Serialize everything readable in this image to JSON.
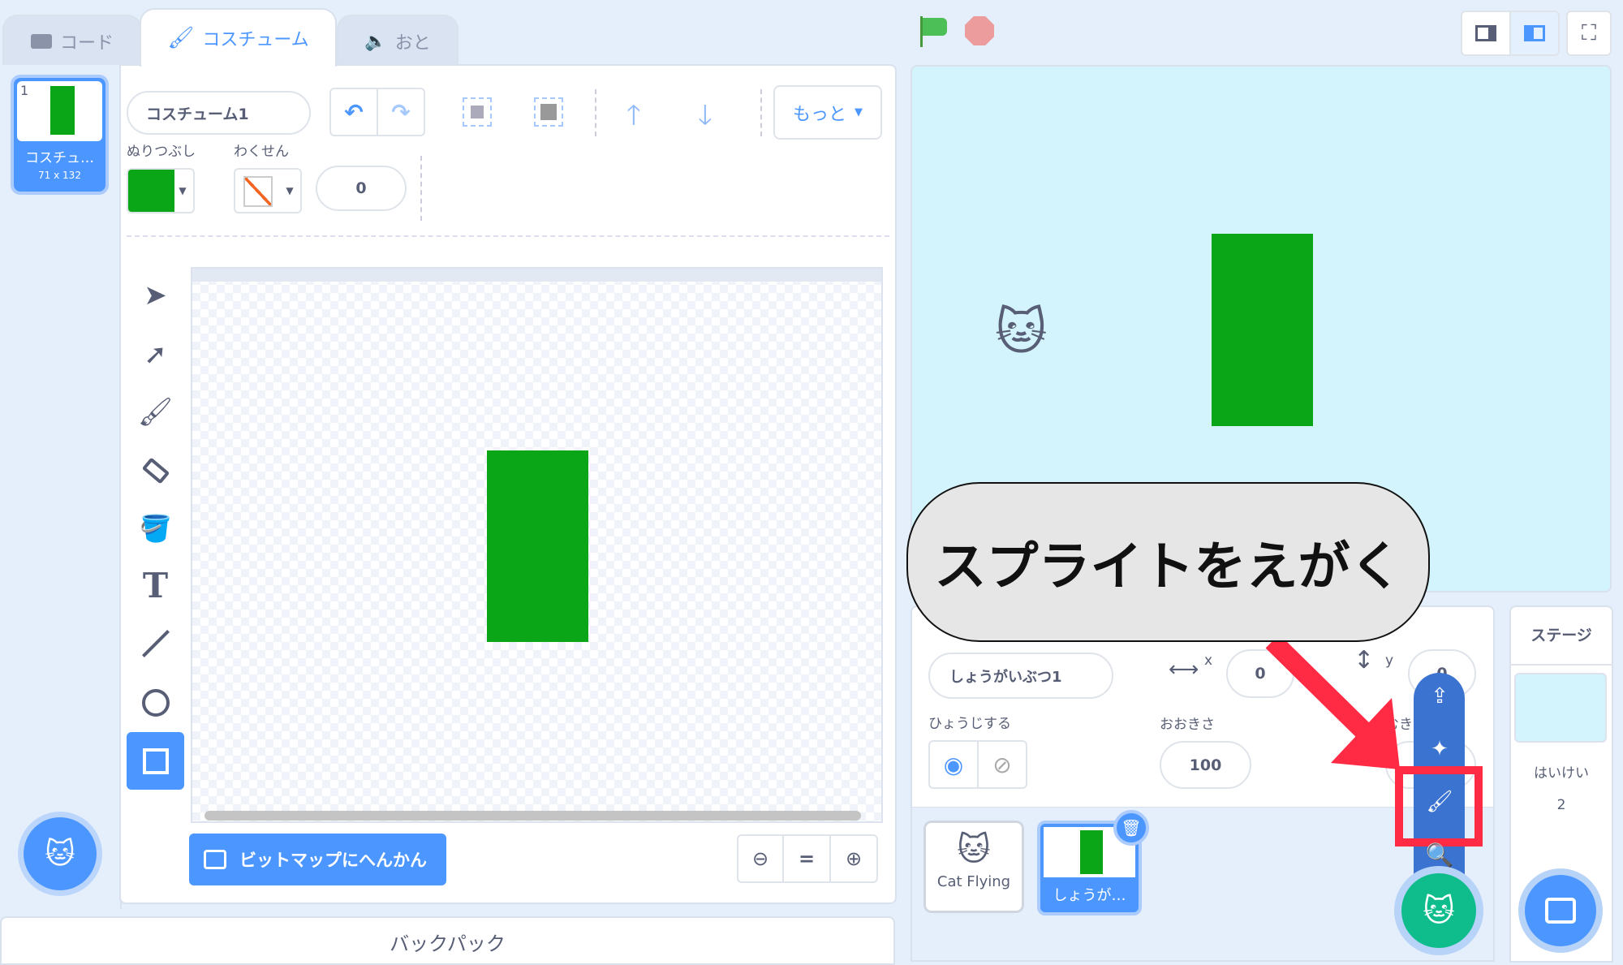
{
  "tabs": [
    {
      "label": "コード",
      "icon": "code-icon"
    },
    {
      "label": "コスチューム",
      "icon": "brush-icon"
    },
    {
      "label": "おと",
      "icon": "speaker-icon"
    }
  ],
  "costume_list": [
    {
      "number": "1",
      "name": "コスチュ…",
      "size": "71 x 132"
    }
  ],
  "editor": {
    "costume_name": "コスチューム1",
    "more_label": "もっと",
    "fill_label": "ぬりつぶし",
    "outline_label": "わくせん",
    "fill_color": "#0aa617",
    "outline_width": "0",
    "convert_label": "ビットマップにへんかん",
    "zoom_reset": "="
  },
  "backpack_label": "バックパック",
  "stage": {
    "background": "#d3f4fc",
    "shape_color": "#0aa617"
  },
  "callout": "スプライトをえがく",
  "sprite_info": {
    "name": "しょうがいぶつ1",
    "x_label": "x",
    "x": "0",
    "y_label": "y",
    "y": "0",
    "show_label": "ひょうじする",
    "size_label": "おおきさ",
    "size": "100",
    "direction_label": "むき"
  },
  "sprites": [
    {
      "name": "Cat Flying"
    },
    {
      "name": "しょうが…",
      "selected": true
    }
  ],
  "stage_panel": {
    "title": "ステージ",
    "backdrops_label": "はいけい",
    "backdrop_count": "2"
  },
  "colors": {
    "accent": "#4c97ff",
    "highlight": "#ff2b44",
    "add_sprite": "#0fbd8c"
  }
}
